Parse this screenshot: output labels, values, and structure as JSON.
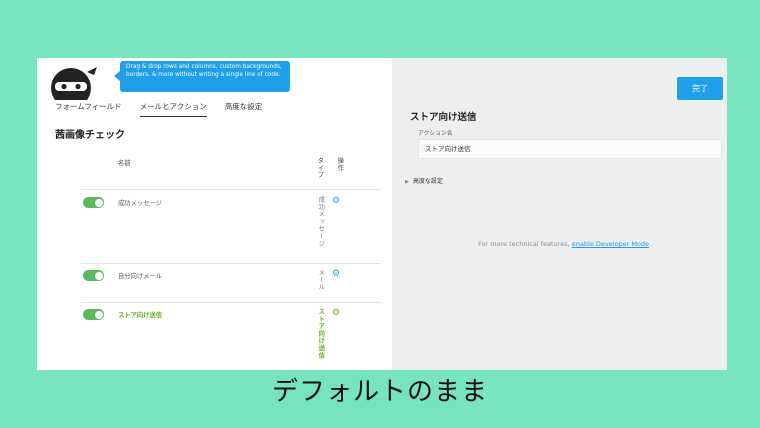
{
  "tooltip": {
    "text": "Drag & drop rows and columns, custom backgrounds, borders, & more without writing a single line of code."
  },
  "tabs": [
    {
      "label": "フォームフィールド"
    },
    {
      "label": "メールとアクション"
    },
    {
      "label": "高度な設定"
    }
  ],
  "active_tab": "メールとアクション",
  "form_title": "茜画像チェック",
  "table": {
    "col_name": "名前",
    "col_type": "タイプ",
    "col_ops": "操作",
    "rows": [
      {
        "enabled": true,
        "name": "成功メッセージ",
        "type": "成功メッセージ",
        "highlighted": false
      },
      {
        "enabled": true,
        "name": "自分向けメール",
        "type": "メール",
        "highlighted": false
      },
      {
        "enabled": true,
        "name": "ストア向け送信",
        "type": "ストア向け送信",
        "highlighted": true
      }
    ]
  },
  "panel": {
    "done_label": "完了",
    "title": "ストア向け送信",
    "action_name_label": "アクション名",
    "action_name_value": "ストア向け送信",
    "advanced_label": "高度な設定",
    "dev_note_prefix": "For more technical features, ",
    "dev_note_link": "enable Developer Mode",
    "dev_note_suffix": "."
  },
  "caption": "デフォルトのまま",
  "colors": {
    "background": "#78e3bf",
    "accent": "#1f9ee9",
    "toggle_on": "#5cb85c",
    "highlight": "#6aab1f"
  }
}
